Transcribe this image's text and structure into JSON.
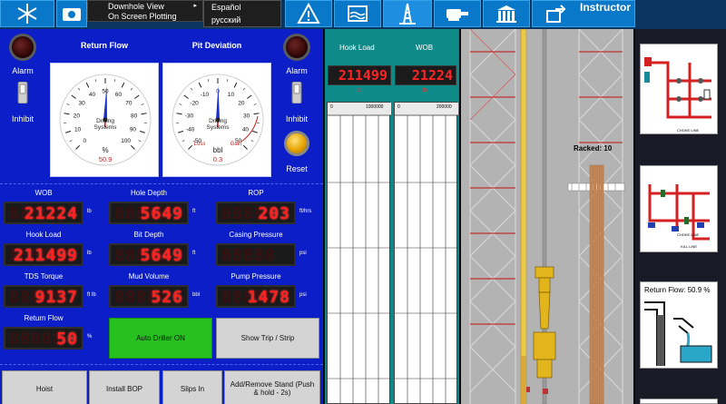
{
  "toolbar": {
    "instructor_label": "Instructor",
    "menu_items": [
      "Downhole View",
      "On Screen Plotting"
    ],
    "languages": [
      "Español",
      "русский"
    ]
  },
  "panel": {
    "alarm_label": "Alarm",
    "inhibit_label": "Inhibit",
    "reset_label": "Reset",
    "gauges": [
      {
        "title": "Return Flow",
        "brand": "Drilling Systems",
        "unit": "%",
        "value": "50.9",
        "needle_value": 50.9,
        "ticks": [
          "0",
          "10",
          "20",
          "30",
          "40",
          "50",
          "60",
          "70",
          "80",
          "90",
          "100"
        ]
      },
      {
        "title": "Pit Deviation",
        "brand": "Drilling Systems",
        "unit": "bbl",
        "value": "0.3",
        "needle_value": 0.3,
        "loss_label": "Loss",
        "gain_label": "Gain",
        "ticks": [
          "-50",
          "-40",
          "-30",
          "-20",
          "-10",
          "0",
          "10",
          "20",
          "30",
          "40",
          "50"
        ]
      }
    ],
    "readouts": [
      {
        "name": "wob",
        "label": "WOB",
        "value": "21224",
        "ghost": "88888",
        "unit": "lb"
      },
      {
        "name": "hole-depth",
        "label": "Hole Depth",
        "value": "5649",
        "ghost": "88888",
        "unit": "ft"
      },
      {
        "name": "rop",
        "label": "ROP",
        "value": "203",
        "ghost": "88888",
        "unit": "ft/hrs"
      },
      {
        "name": "hook-load",
        "label": "Hook Load",
        "value": "211499",
        "ghost": "888888",
        "unit": "lb"
      },
      {
        "name": "bit-depth",
        "label": "Bit Depth",
        "value": "5649",
        "ghost": "88888",
        "unit": "ft"
      },
      {
        "name": "casing-pressure",
        "label": "Casing Pressure",
        "value": "",
        "ghost": "88888",
        "unit": "psi"
      },
      {
        "name": "tds-torque",
        "label": "TDS Torque",
        "value": "9137",
        "ghost": "88888",
        "unit": "ft lb"
      },
      {
        "name": "mud-volume",
        "label": "Mud Volume",
        "value": "526",
        "ghost": "88888",
        "unit": "bbl"
      },
      {
        "name": "pump-pressure",
        "label": "Pump Pressure",
        "value": "1478",
        "ghost": "88888",
        "unit": "psi"
      },
      {
        "name": "return-flow",
        "label": "Return Flow",
        "value": "50",
        "ghost": "88888",
        "unit": "%"
      }
    ],
    "buttons": {
      "auto_driller": "Auto Driller ON",
      "show_trip": "Show Trip / Strip",
      "hoist": "Hoist",
      "install_bop": "Install BOP",
      "slips_in": "Slips In",
      "add_remove_stand": "Add/Remove Stand (Push & hold - 2s)"
    }
  },
  "recorder": {
    "hook_load_title": "Hook Load",
    "wob_title": "WOB",
    "hook_load_value": "211499",
    "wob_value": "21224",
    "hook_load_unit": "lb",
    "wob_unit": "lb",
    "hook_scale": [
      "0",
      "1000000"
    ],
    "wob_scale": [
      "0",
      "200000"
    ]
  },
  "derrick": {
    "racked_label": "Racked: 10"
  },
  "schematics": {
    "choke_line_1": "CHOKE LINE",
    "choke_line_2": "CHOKE LINE",
    "kill_line": "KILL LINE",
    "return_flow_label": "Return Flow:",
    "return_flow_value": "50.9 %"
  },
  "colors": {
    "panel_blue": "#0b1ec8",
    "toolbar_blue": "#0a78c8",
    "recorder_teal": "#0e8a88",
    "led_red": "#ff2020",
    "button_green": "#27c11f"
  }
}
